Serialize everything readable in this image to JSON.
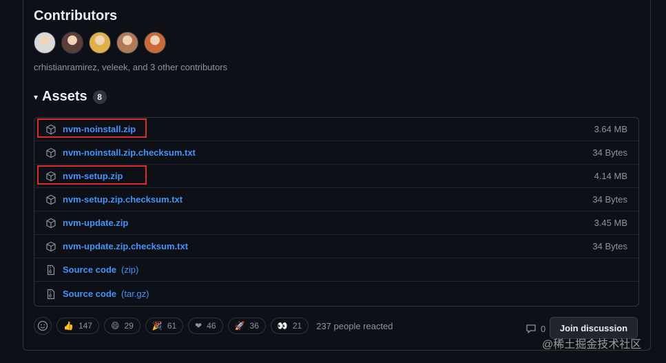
{
  "contributors": {
    "title": "Contributors",
    "avatars": [
      {
        "name": "avatar-1",
        "color": "#d9d9d9"
      },
      {
        "name": "avatar-2",
        "color": "#5a3e3a"
      },
      {
        "name": "avatar-3",
        "color": "#e0b04a"
      },
      {
        "name": "avatar-4",
        "color": "#b07a5a"
      },
      {
        "name": "avatar-5",
        "color": "#c86a3a"
      }
    ],
    "text": "crhistianramirez, veleek, and 3 other contributors"
  },
  "assets": {
    "caret": "▾",
    "title": "Assets",
    "count": "8",
    "items": [
      {
        "name": "nvm-noinstall.zip",
        "size": "3.64 MB",
        "icon": "package-icon",
        "highlighted": true
      },
      {
        "name": "nvm-noinstall.zip.checksum.txt",
        "size": "34 Bytes",
        "icon": "package-icon"
      },
      {
        "name": "nvm-setup.zip",
        "size": "4.14 MB",
        "icon": "package-icon",
        "highlighted": true
      },
      {
        "name": "nvm-setup.zip.checksum.txt",
        "size": "34 Bytes",
        "icon": "package-icon"
      },
      {
        "name": "nvm-update.zip",
        "size": "3.45 MB",
        "icon": "package-icon"
      },
      {
        "name": "nvm-update.zip.checksum.txt",
        "size": "34 Bytes",
        "icon": "package-icon"
      },
      {
        "name": "Source code",
        "suffix": "(zip)",
        "icon": "file-zip-icon"
      },
      {
        "name": "Source code",
        "suffix": "(tar.gz)",
        "icon": "file-zip-icon"
      }
    ]
  },
  "reactions": {
    "items": [
      {
        "emoji": "👍",
        "count": "147"
      },
      {
        "emoji": "😄",
        "count": "29"
      },
      {
        "emoji": "🎉",
        "count": "61"
      },
      {
        "emoji": "❤",
        "count": "46"
      },
      {
        "emoji": "🚀",
        "count": "36"
      },
      {
        "emoji": "👀",
        "count": "21"
      }
    ],
    "summary": "237 people reacted"
  },
  "discussion": {
    "comment_count": "0",
    "join_label": "Join discussion"
  },
  "watermark": "@稀土掘金技术社区",
  "colors": {
    "background": "#0d1117",
    "link": "#4493f8",
    "muted": "#8b949e",
    "highlight_box": "#e02b2b"
  }
}
